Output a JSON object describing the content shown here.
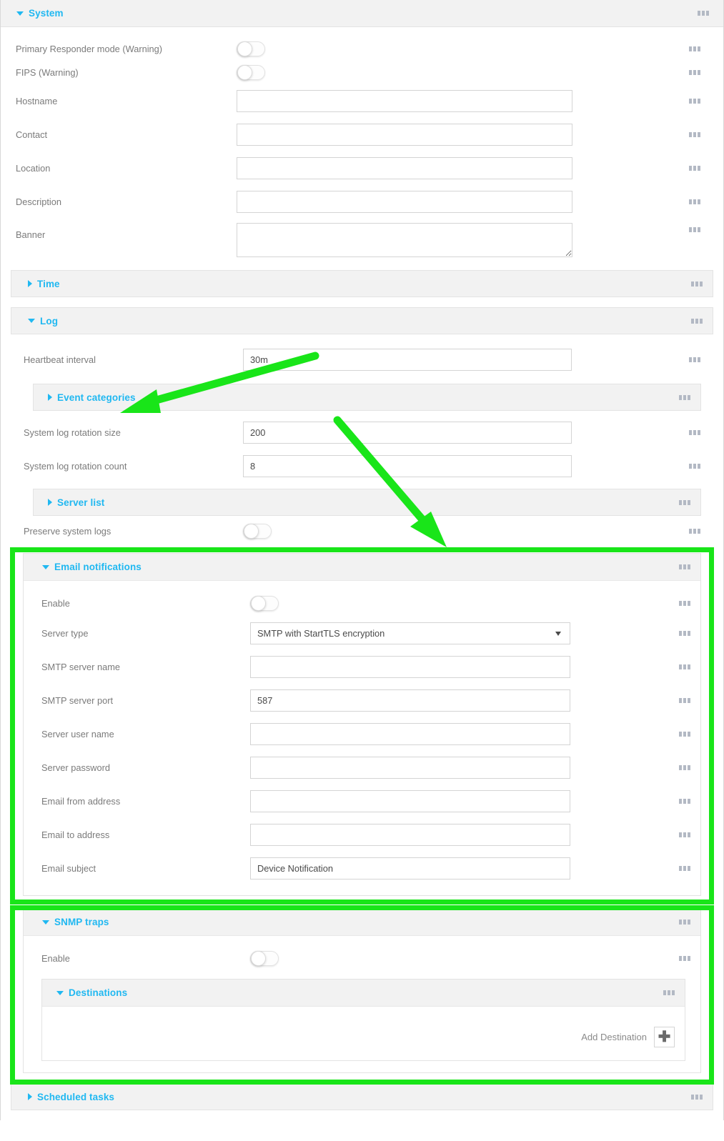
{
  "colors": {
    "accent": "#20b8f1",
    "label": "#7b7b7b",
    "panel_bg": "#f2f2f2",
    "highlight": "#19e519"
  },
  "sections": {
    "system": {
      "title": "System",
      "expanded": true,
      "rows": [
        {
          "label": "Primary Responder mode (Warning)",
          "type": "toggle",
          "value": "off"
        },
        {
          "label": "FIPS (Warning)",
          "type": "toggle",
          "value": "off"
        },
        {
          "label": "Hostname",
          "type": "text",
          "value": ""
        },
        {
          "label": "Contact",
          "type": "text",
          "value": ""
        },
        {
          "label": "Location",
          "type": "text",
          "value": ""
        },
        {
          "label": "Description",
          "type": "text",
          "value": ""
        },
        {
          "label": "Banner",
          "type": "textarea",
          "value": ""
        }
      ]
    },
    "time": {
      "title": "Time",
      "expanded": false
    },
    "log": {
      "title": "Log",
      "expanded": true,
      "heartbeat": {
        "label": "Heartbeat interval",
        "value": "30m"
      },
      "event_categories": {
        "title": "Event categories",
        "expanded": false
      },
      "rotation_size": {
        "label": "System log rotation size",
        "value": "200"
      },
      "rotation_count": {
        "label": "System log rotation count",
        "value": "8"
      },
      "server_list": {
        "title": "Server list",
        "expanded": false
      },
      "preserve": {
        "label": "Preserve system logs",
        "value": "off"
      },
      "email": {
        "title": "Email notifications",
        "expanded": true,
        "rows": [
          {
            "label": "Enable",
            "type": "toggle",
            "value": "off"
          },
          {
            "label": "Server type",
            "type": "select",
            "value": "SMTP with StartTLS encryption"
          },
          {
            "label": "SMTP server name",
            "type": "text",
            "value": ""
          },
          {
            "label": "SMTP server port",
            "type": "text",
            "value": "587"
          },
          {
            "label": "Server user name",
            "type": "text",
            "value": ""
          },
          {
            "label": "Server password",
            "type": "text",
            "value": ""
          },
          {
            "label": "Email from address",
            "type": "text",
            "value": ""
          },
          {
            "label": "Email to address",
            "type": "text",
            "value": ""
          },
          {
            "label": "Email subject",
            "type": "text",
            "value": "Device Notification"
          }
        ]
      },
      "snmp": {
        "title": "SNMP traps",
        "expanded": true,
        "enable": {
          "label": "Enable",
          "value": "off"
        },
        "destinations": {
          "title": "Destinations",
          "expanded": true,
          "add_label": "Add Destination",
          "add_icon": "plus-icon"
        }
      }
    },
    "scheduled_tasks": {
      "title": "Scheduled tasks",
      "expanded": false
    }
  },
  "annotations": {
    "highlight_boxes": [
      {
        "name": "email-notifications-highlight"
      },
      {
        "name": "snmp-traps-highlight"
      }
    ],
    "arrows": [
      {
        "name": "arrow-to-event-categories"
      },
      {
        "name": "arrow-to-email-notifications"
      }
    ]
  }
}
